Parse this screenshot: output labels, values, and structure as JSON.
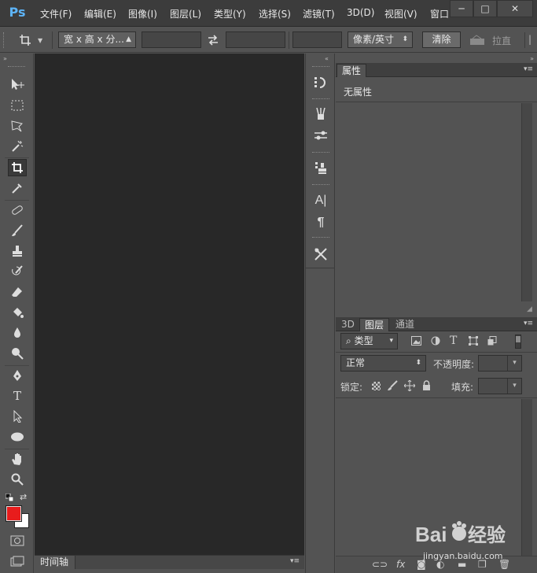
{
  "app": {
    "logo": "Ps"
  },
  "menu": [
    "文件(F)",
    "编辑(E)",
    "图像(I)",
    "图层(L)",
    "类型(Y)",
    "选择(S)",
    "滤镜(T)",
    "3D(D)",
    "视图(V)",
    "窗口"
  ],
  "window_controls": {
    "minimize": "─",
    "maximize": "□",
    "close": "✕"
  },
  "options_bar": {
    "ratio_preset": "宽 x 高 x 分...",
    "width_value": "",
    "height_value": "",
    "resolution_value": "",
    "unit": "像素/英寸",
    "clear_label": "清除",
    "straighten_label": "拉直"
  },
  "timeline_tab": "时间轴",
  "properties_panel": {
    "tab": "属性",
    "content": "无属性"
  },
  "layers_panel": {
    "tabs": [
      "3D",
      "图层",
      "通道"
    ],
    "active_tab": "图层",
    "filter_kind": "类型",
    "blend_mode": "正常",
    "opacity_label": "不透明度:",
    "opacity_value": "",
    "lock_label": "锁定:",
    "fill_label": "填充:",
    "fill_value": ""
  },
  "colors": {
    "foreground": "#e81c1c",
    "background": "#ffffff",
    "accent": "#5db3f6"
  },
  "watermark": "Baidu经验 jingyan.baidu.com"
}
